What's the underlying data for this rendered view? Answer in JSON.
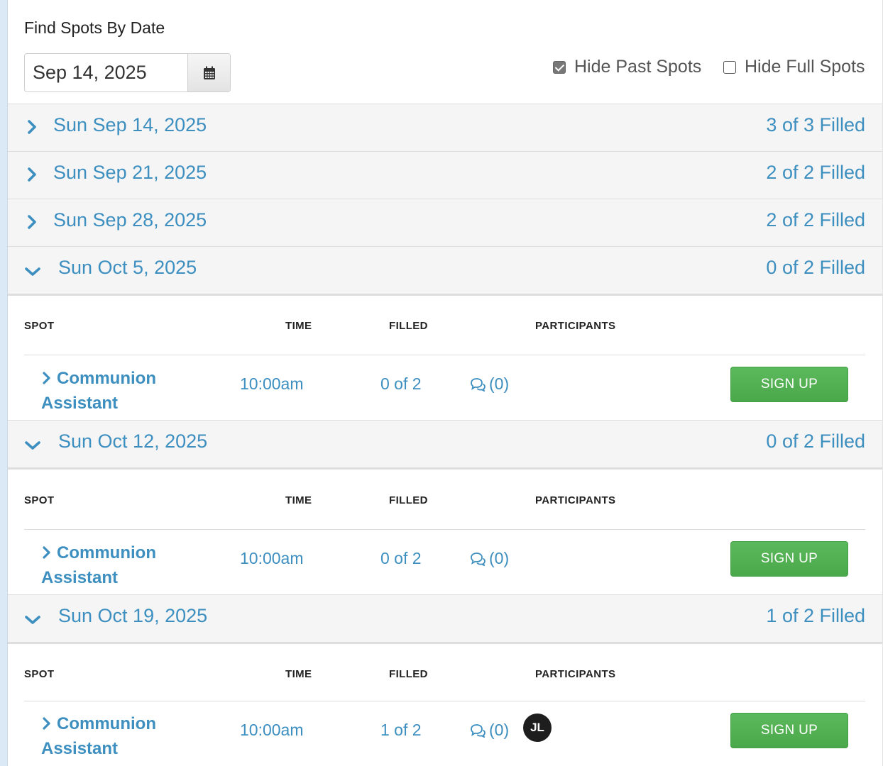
{
  "find_title": "Find Spots By Date",
  "date_picker": {
    "value": "Sep 14, 2025",
    "icon": "calendar-icon"
  },
  "filters": {
    "hide_past": {
      "label": "Hide Past Spots",
      "checked": true
    },
    "hide_full": {
      "label": "Hide Full Spots",
      "checked": false
    }
  },
  "collapsed_dates": [
    {
      "date": "Sun Sep 14, 2025",
      "filled": "3 of 3 Filled"
    },
    {
      "date": "Sun Sep 21, 2025",
      "filled": "2 of 2 Filled"
    },
    {
      "date": "Sun Sep 28, 2025",
      "filled": "2 of 2 Filled"
    }
  ],
  "columns": {
    "spot": "SPOT",
    "time": "TIME",
    "filled": "FILLED",
    "participants": "PARTICIPANTS"
  },
  "expanded_dates": [
    {
      "date": "Sun Oct 5, 2025",
      "filled": "0 of 2 Filled",
      "spot": {
        "name": "Communion Assistant",
        "time": "10:00am",
        "filled": "0 of 2",
        "comments": "(0)",
        "participants": [],
        "button": "SIGN UP"
      }
    },
    {
      "date": "Sun Oct 12, 2025",
      "filled": "0 of 2 Filled",
      "spot": {
        "name": "Communion Assistant",
        "time": "10:00am",
        "filled": "0 of 2",
        "comments": "(0)",
        "participants": [],
        "button": "SIGN UP"
      }
    },
    {
      "date": "Sun Oct 19, 2025",
      "filled": "1 of 2 Filled",
      "spot": {
        "name": "Communion Assistant",
        "time": "10:00am",
        "filled": "1 of 2",
        "comments": "(0)",
        "participants": [
          "JL"
        ],
        "button": "SIGN UP"
      }
    }
  ],
  "colors": {
    "link": "#3d8fc0",
    "button": "#5cb85c",
    "row_bg": "#f5f5f5"
  }
}
